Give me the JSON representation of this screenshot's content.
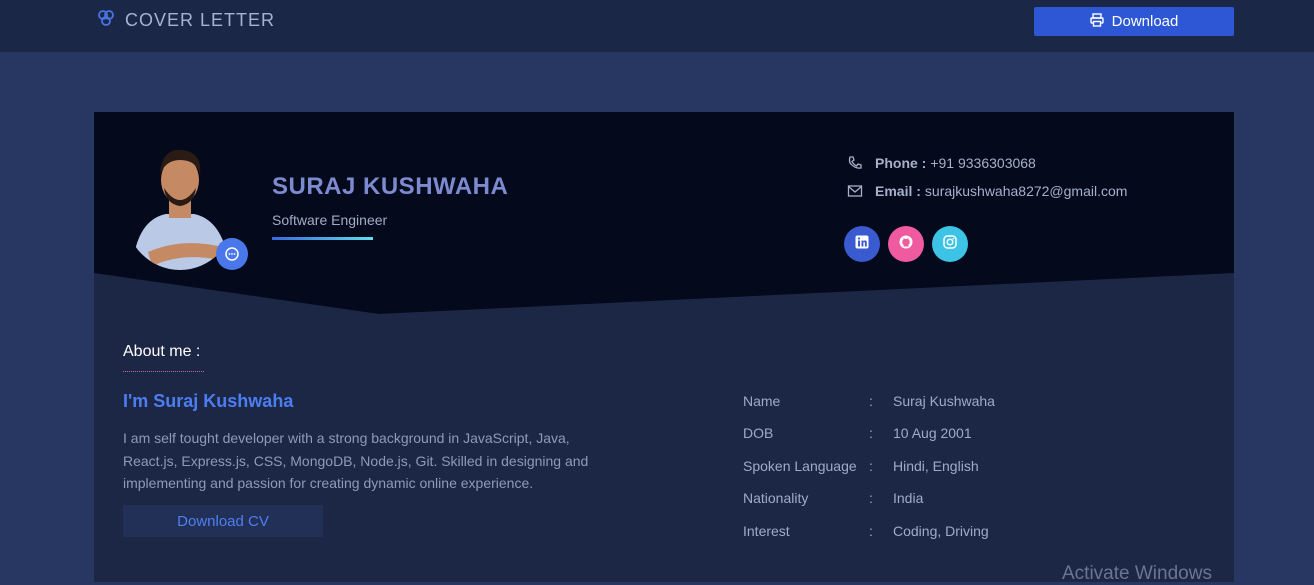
{
  "topbar": {
    "brand_title": "COVER LETTER",
    "brand_icon": "circles-logo-icon",
    "download_label": "Download",
    "download_icon": "printer-icon"
  },
  "profile": {
    "name": "SURAJ KUSHWAHA",
    "role": "Software Engineer",
    "badge_icon": "chat-bubble-icon"
  },
  "contact": {
    "phone_label": "Phone :",
    "phone_value": "+91 9336303068",
    "email_label": "Email :",
    "email_value": "surajkushwaha8272@gmail.com"
  },
  "social": [
    {
      "name": "linkedin-icon",
      "color": "#3a5bd0"
    },
    {
      "name": "github-icon",
      "color": "#f05a9f"
    },
    {
      "name": "instagram-icon",
      "color": "#3cc3e6"
    }
  ],
  "about": {
    "title": "About me :",
    "intro": "I'm Suraj Kushwaha",
    "description": "I am self tought developer with a strong background in JavaScript, Java, React.js, Express.js, CSS, MongoDB, Node.js, Git. Skilled in designing and implementing and passion for creating dynamic online experience.",
    "cv_button": "Download CV"
  },
  "info": [
    {
      "key": "Name",
      "sep": ":",
      "value": "Suraj Kushwaha"
    },
    {
      "key": "DOB",
      "sep": ":",
      "value": "10 Aug 2001"
    },
    {
      "key": "Spoken Language",
      "sep": ":",
      "value": "Hindi, English"
    },
    {
      "key": "Nationality",
      "sep": ":",
      "value": "India"
    },
    {
      "key": "Interest",
      "sep": ":",
      "value": "Coding, Driving"
    }
  ],
  "watermark": "Activate Windows",
  "colors": {
    "page_bg": "#283762",
    "topbar_bg": "#1b2746",
    "accent": "#2e57d6",
    "hero_bg": "#040a1c"
  }
}
